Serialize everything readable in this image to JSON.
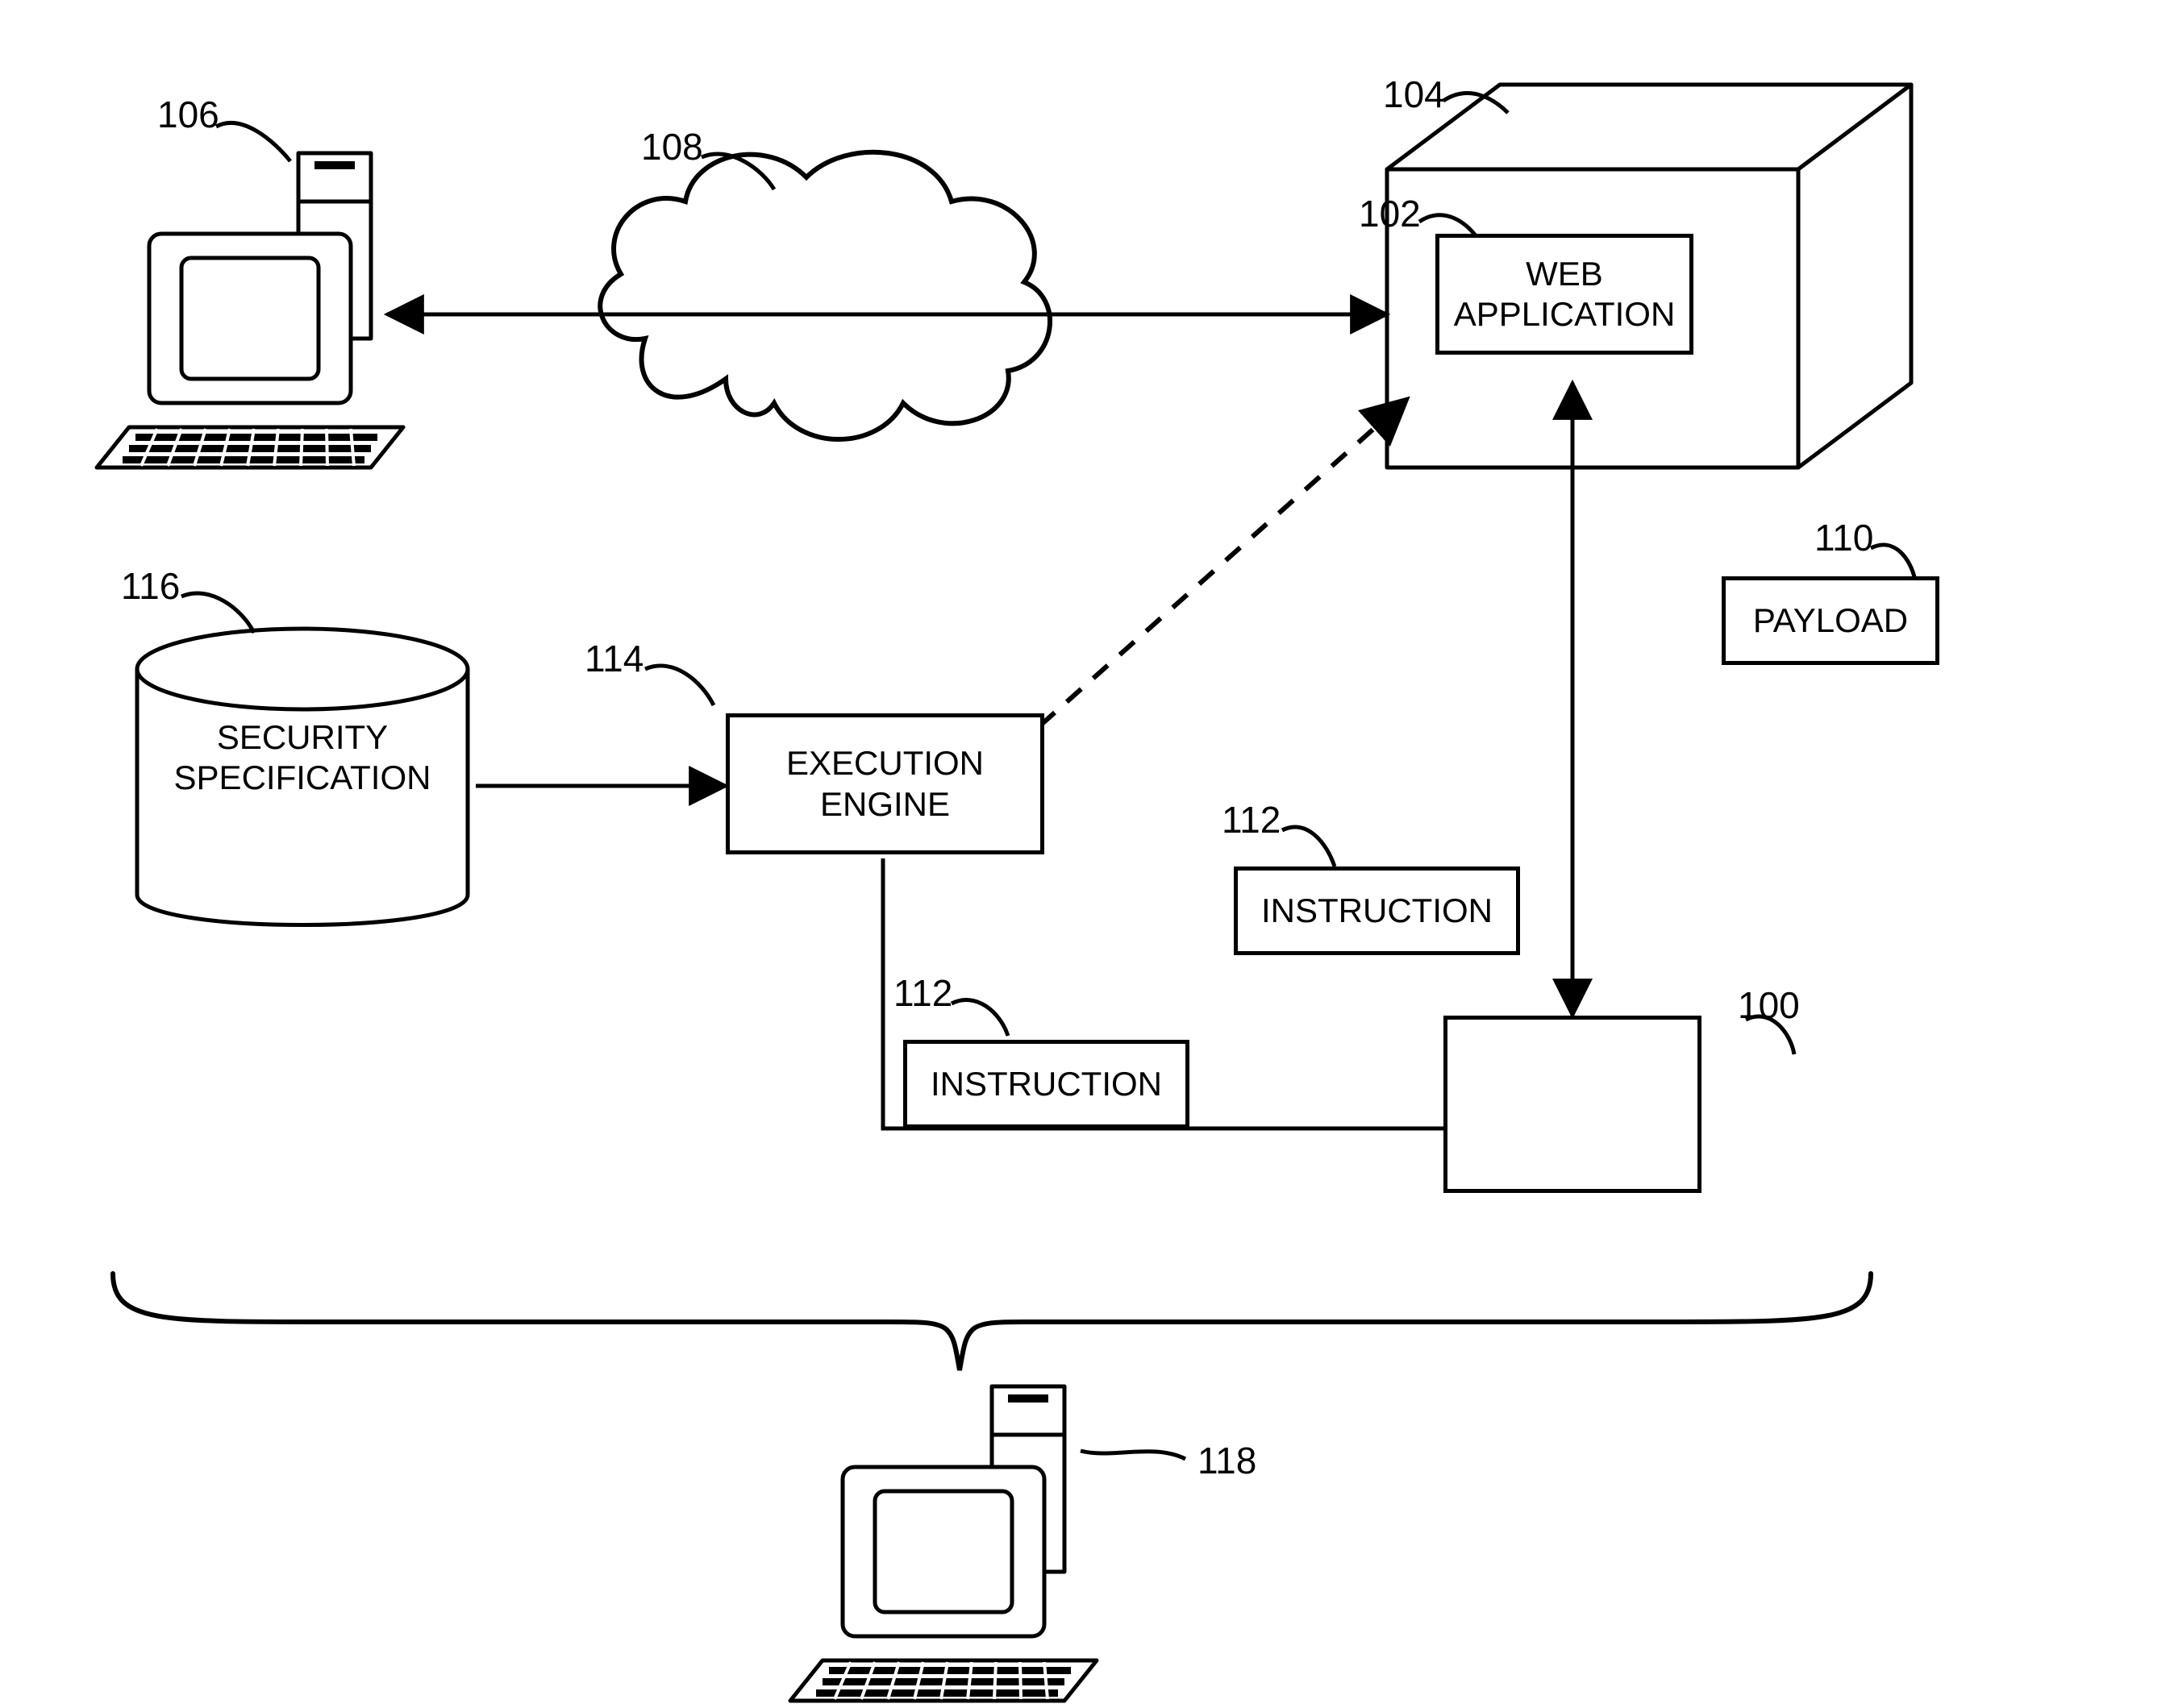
{
  "labels": {
    "ref_106": "106",
    "ref_108": "108",
    "ref_104": "104",
    "ref_102": "102",
    "ref_116": "116",
    "ref_114": "114",
    "ref_112_a": "112",
    "ref_112_b": "112",
    "ref_110": "110",
    "ref_100": "100",
    "ref_118": "118"
  },
  "boxes": {
    "web_application": "WEB\nAPPLICATION",
    "payload": "PAYLOAD",
    "security_specification": "SECURITY\nSPECIFICATION",
    "execution_engine": "EXECUTION\nENGINE",
    "instruction_a": "INSTRUCTION",
    "instruction_b": "INSTRUCTION"
  }
}
